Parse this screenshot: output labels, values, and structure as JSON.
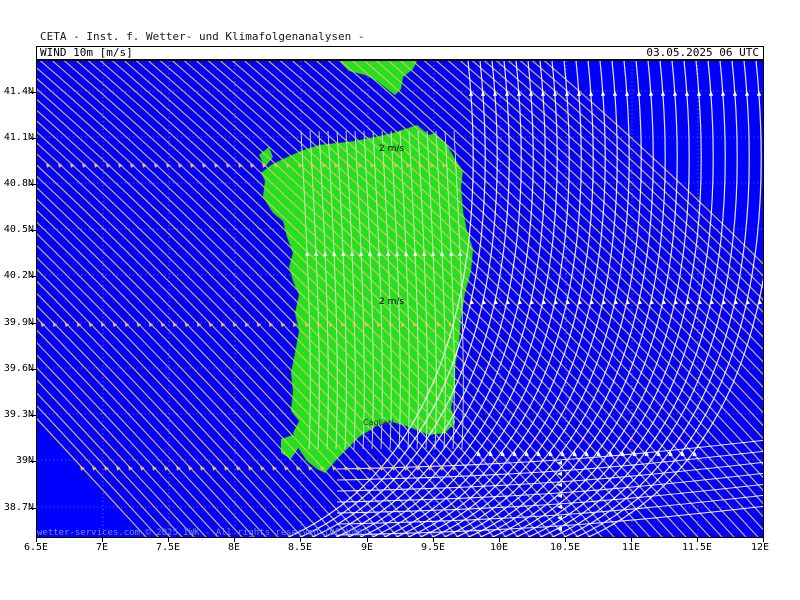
{
  "header": {
    "title": "CETA - Inst. f. Wetter- und Klimafolgenanalysen -",
    "variable": "WIND 10m [m/s]",
    "valid_time": "03.05.2025 06 UTC"
  },
  "map": {
    "lat_labels": [
      "41.4N",
      "41.1N",
      "40.8N",
      "40.5N",
      "40.2N",
      "39.9N",
      "39.6N",
      "39.3N",
      "39N",
      "38.7N"
    ],
    "lon_labels": [
      "6.5E",
      "7E",
      "7.5E",
      "8E",
      "8.5E",
      "9E",
      "9.5E",
      "10E",
      "10.5E",
      "11E",
      "11.5E",
      "12E"
    ],
    "speed_labels": [
      "2 m/s",
      "2 m/s"
    ],
    "place_labels": [
      "Cagliari"
    ],
    "copyright": "wetter-services.com © 2025 IWK - All rights reserved (DE-V48)",
    "colors": {
      "sea": "#0000ff",
      "land": "#22e022",
      "streamline_west": "#f0c050",
      "streamline_east": "#ffffff",
      "grid": "#9fc0ff"
    }
  }
}
